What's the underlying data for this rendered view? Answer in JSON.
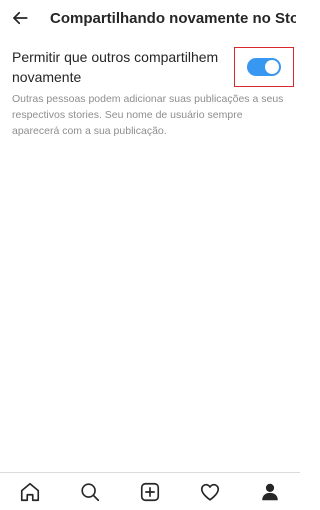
{
  "header": {
    "title": "Compartilhando novamente no Stor",
    "back_icon": "arrow-left-icon"
  },
  "setting": {
    "label": "Permitir que outros compartilhem novamente",
    "description": "Outras pessoas podem adicionar suas publicações a seus respectivos stories. Seu nome de usuário sempre aparecerá com a sua publicação.",
    "toggle_on": true,
    "toggle_color": "#3897f0",
    "highlight_color": "#d8272f"
  },
  "bottom_nav": {
    "items": [
      "home-icon",
      "search-icon",
      "plus-square-icon",
      "heart-icon",
      "profile-icon"
    ]
  }
}
